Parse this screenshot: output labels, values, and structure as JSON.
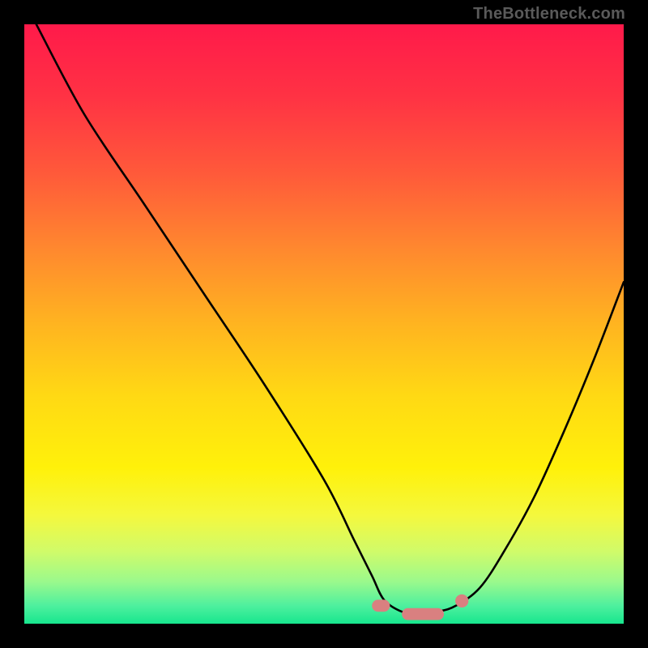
{
  "watermark": {
    "text": "TheBottleneck.com"
  },
  "gradient": {
    "stops": [
      {
        "offset": 0.0,
        "color": "#ff1a4a"
      },
      {
        "offset": 0.12,
        "color": "#ff3244"
      },
      {
        "offset": 0.25,
        "color": "#ff5a3a"
      },
      {
        "offset": 0.38,
        "color": "#ff8a2e"
      },
      {
        "offset": 0.5,
        "color": "#ffb420"
      },
      {
        "offset": 0.62,
        "color": "#ffd914"
      },
      {
        "offset": 0.74,
        "color": "#fff10a"
      },
      {
        "offset": 0.82,
        "color": "#f4f83e"
      },
      {
        "offset": 0.88,
        "color": "#d0fb6a"
      },
      {
        "offset": 0.93,
        "color": "#9af98c"
      },
      {
        "offset": 0.97,
        "color": "#4ef09e"
      },
      {
        "offset": 1.0,
        "color": "#17e68e"
      }
    ]
  },
  "chart_data": {
    "type": "line",
    "title": "",
    "xlabel": "",
    "ylabel": "",
    "xlim": [
      0,
      100
    ],
    "ylim": [
      0,
      100
    ],
    "grid": false,
    "series": [
      {
        "name": "bottleneck-curve",
        "x": [
          2,
          10,
          20,
          30,
          40,
          50,
          55,
          58,
          60,
          63,
          66,
          69,
          72,
          76,
          80,
          85,
          90,
          95,
          100
        ],
        "y": [
          100,
          85,
          70,
          55,
          40,
          24,
          14,
          8,
          4,
          2,
          1.5,
          2,
          3,
          6,
          12,
          21,
          32,
          44,
          57
        ]
      }
    ],
    "markers": [
      {
        "shape": "rounded-bar",
        "x0": 58,
        "x1": 61,
        "y": 3.0,
        "color": "#d98080"
      },
      {
        "shape": "rounded-bar",
        "x0": 63,
        "x1": 70,
        "y": 1.6,
        "color": "#d98080"
      },
      {
        "shape": "dot",
        "x": 73,
        "y": 3.8,
        "r": 1.1,
        "color": "#d98080"
      }
    ]
  }
}
